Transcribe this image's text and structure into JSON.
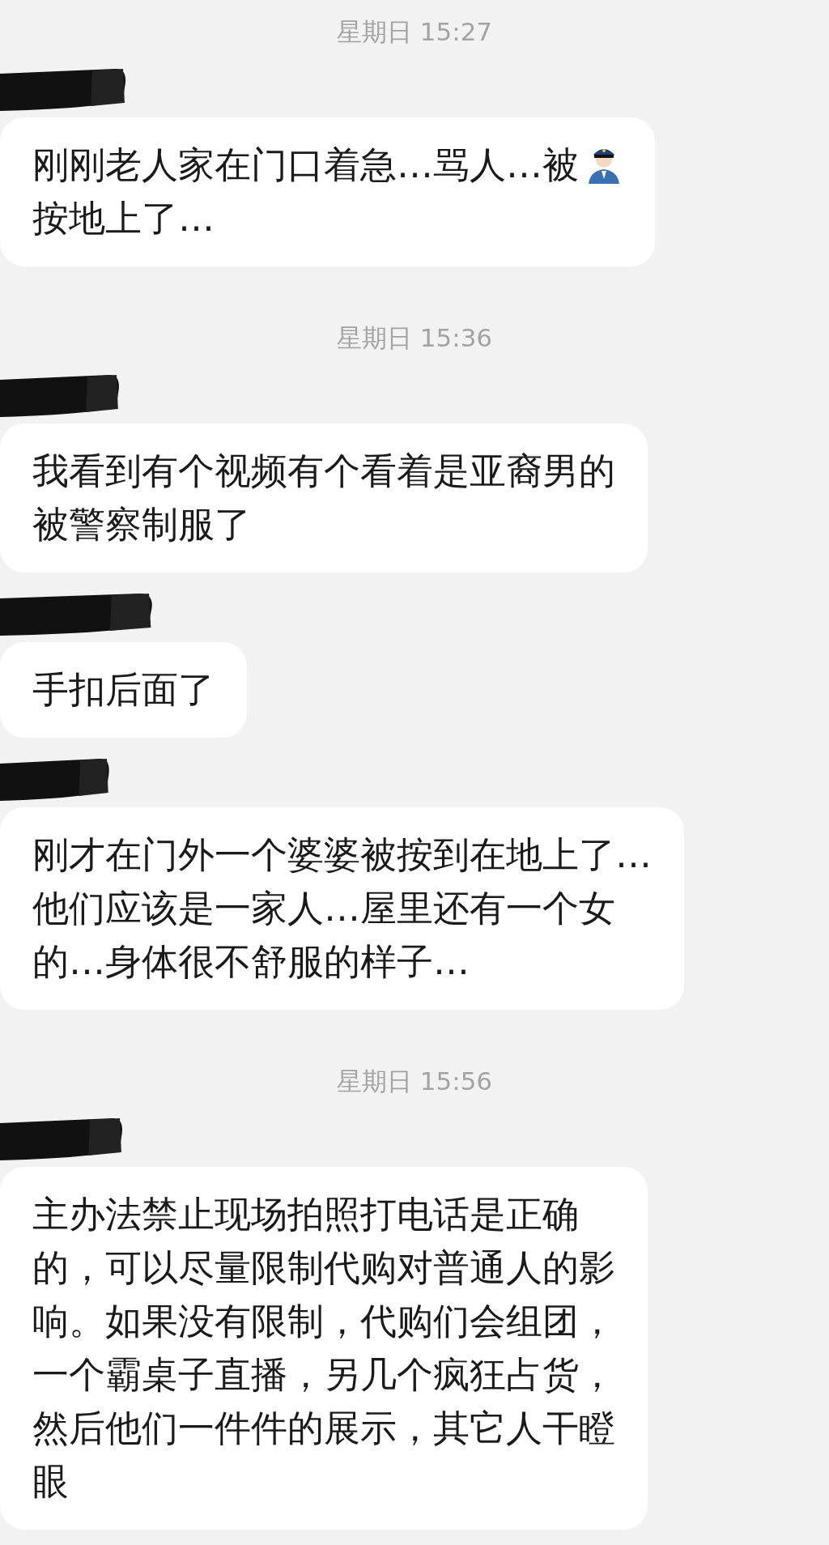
{
  "items": [
    {
      "kind": "time",
      "text": "星期日 15:27"
    },
    {
      "kind": "message",
      "sender_redacted": true,
      "icon_after_first_line": true,
      "lines": [
        "刚刚老人家在门口着急…骂人…被",
        "按地上了…"
      ]
    },
    {
      "kind": "time",
      "text": "星期日 15:36"
    },
    {
      "kind": "message",
      "sender_redacted": true,
      "icon_after_first_line": false,
      "lines": [
        "我看到有个视频有个看着是亚裔男的",
        "被警察制服了"
      ]
    },
    {
      "kind": "message",
      "sender_redacted": true,
      "icon_after_first_line": false,
      "lines": [
        "手扣后面了"
      ]
    },
    {
      "kind": "message",
      "sender_redacted": true,
      "icon_after_first_line": false,
      "lines": [
        "刚才在门外一个婆婆被按到在地上了…",
        "他们应该是一家人…屋里还有一个女",
        "的…身体很不舒服的样子…"
      ]
    },
    {
      "kind": "time",
      "text": "星期日 15:56"
    },
    {
      "kind": "message",
      "sender_redacted": true,
      "icon_after_first_line": false,
      "lines": [
        "主办法禁止现场拍照打电话是正确",
        "的，可以尽量限制代购对普通人的影",
        "响。如果没有限制，代购们会组团，",
        "一个霸桌子直播，另几个疯狂占货，",
        "然后他们一件件的展示，其它人干瞪",
        "眼"
      ]
    }
  ]
}
